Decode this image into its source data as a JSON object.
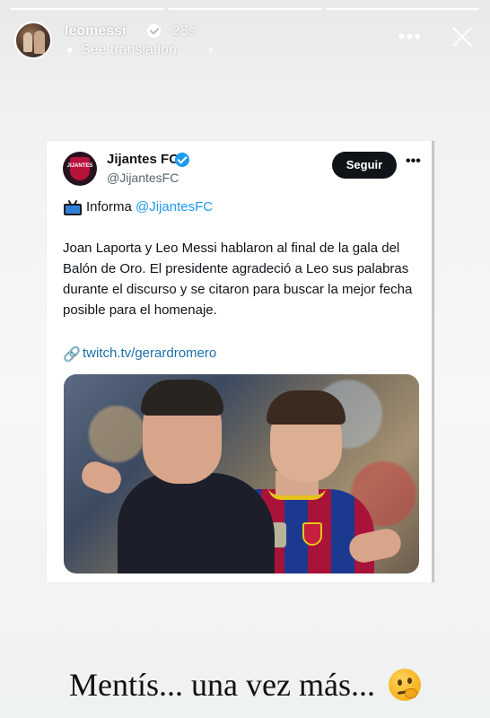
{
  "story": {
    "username": "leomessi",
    "time": "28s",
    "translate_label": "See translation",
    "progress_segments": 3,
    "progress_active": 3
  },
  "tweet": {
    "name": "Jijantes FC",
    "handle": "@JijantesFC",
    "follow_label": "Seguir",
    "informa_label": "Informa",
    "informa_mention": "@JijantesFC",
    "body": "Joan Laporta y Leo Messi hablaron al final de la gala del Balón de Oro. El presidente agradeció a Leo sus palabras  durante el discurso y se citaron para buscar la mejor fecha posible para el homenaje.",
    "link": "twitch.tv/gerardromero",
    "avatar_logo_text": "JIJANTES"
  },
  "caption": {
    "text": "Mentís... una vez más...",
    "emoji": "thinking-face"
  },
  "icons": {
    "verified_color": "#1d9bf0",
    "tv": "television-icon",
    "link": "link-icon"
  }
}
